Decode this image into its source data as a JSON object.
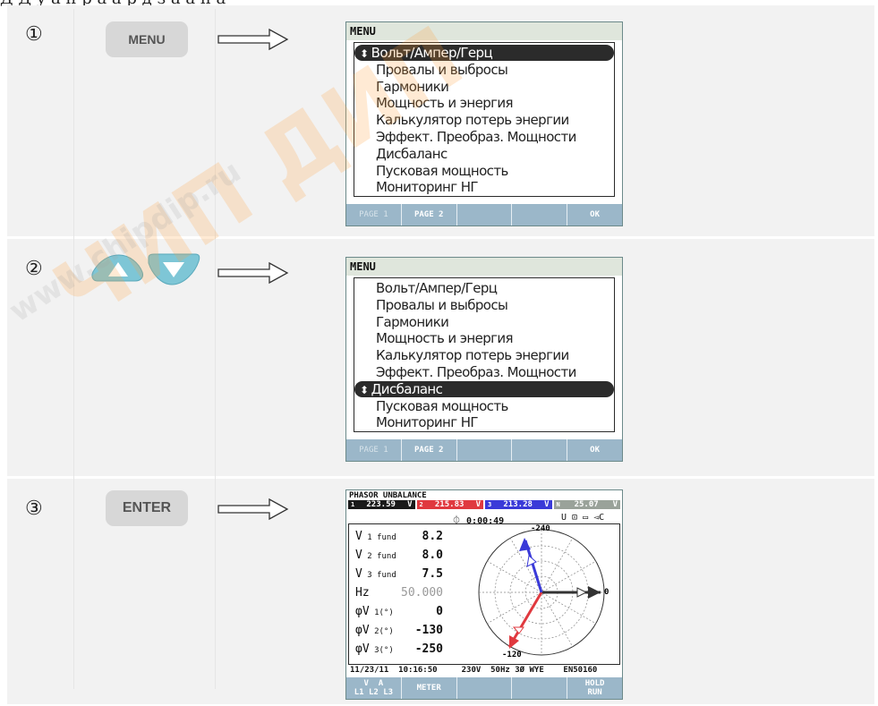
{
  "top_text": "Д    Д    у  а  н    р   а    а   р    д    з   а  а  н   а",
  "steps": [
    {
      "number": "①",
      "button": "MENU",
      "menu_title": "MENU",
      "items": [
        "Вольт/Ампер/Герц",
        "Провалы и выбросы",
        "Гармоники",
        "Мощность и энергия",
        "Калькулятор потерь энергии",
        "Эффект. Преобраз. Мощности",
        "Дисбаланс",
        "Пусковая мощность",
        "Мониторинг НГ"
      ],
      "selected_index": 0,
      "fkeys": [
        "PAGE 1",
        "PAGE 2",
        "",
        "",
        "OK"
      ]
    },
    {
      "number": "②",
      "button_up": "up-arrow",
      "button_down": "down-arrow",
      "menu_title": "MENU",
      "items": [
        "Вольт/Ампер/Герц",
        "Провалы и выбросы",
        "Гармоники",
        "Мощность и энергия",
        "Калькулятор потерь энергии",
        "Эффект. Преобраз. Мощности",
        "Дисбаланс",
        "Пусковая мощность",
        "Мониторинг НГ"
      ],
      "selected_index": 6,
      "fkeys": [
        "PAGE 1",
        "PAGE 2",
        "",
        "",
        "OK"
      ]
    },
    {
      "number": "③",
      "button": "ENTER",
      "phasor": {
        "title": "PHASOR UNBALANCE",
        "channels": [
          {
            "idx": "1",
            "value": "223.59",
            "unit": "V",
            "bg": "#1a1a1a"
          },
          {
            "idx": "2",
            "value": "215.83",
            "unit": "V",
            "bg": "#e0393f"
          },
          {
            "idx": "3",
            "value": "213.28",
            "unit": "V",
            "bg": "#3a3ad8"
          },
          {
            "idx": "N",
            "value": "25.07",
            "unit": "V",
            "bg": "#9aa29a"
          }
        ],
        "timer": "0:00:49",
        "status_icons": "U ⊡ ▭ ◅C",
        "rows": [
          {
            "label": "V",
            "sub": "1 fund",
            "value": "8.2"
          },
          {
            "label": "V",
            "sub": "2 fund",
            "value": "8.0"
          },
          {
            "label": "V",
            "sub": "3 fund",
            "value": "7.5"
          },
          {
            "label": "Hz",
            "sub": "",
            "value": "50.000"
          },
          {
            "label": "φV",
            "sub": "1(°)",
            "value": "0"
          },
          {
            "label": "φV",
            "sub": "2(°)",
            "value": "-130"
          },
          {
            "label": "φV",
            "sub": "3(°)",
            "value": "-250"
          }
        ],
        "label_top": "-240",
        "label_right": "0",
        "label_bottom": "-120",
        "footer": "11/23/11  10:16:50     230V  50Hz 3Ø WYE    EN50160",
        "fkeys": [
          "V  A\nL1 L2 L3",
          "METER",
          "",
          "",
          "HOLD\nRUN"
        ]
      }
    }
  ],
  "watermark": "www.chipdip.ru",
  "brand_wm": "ЧИП ДИП"
}
